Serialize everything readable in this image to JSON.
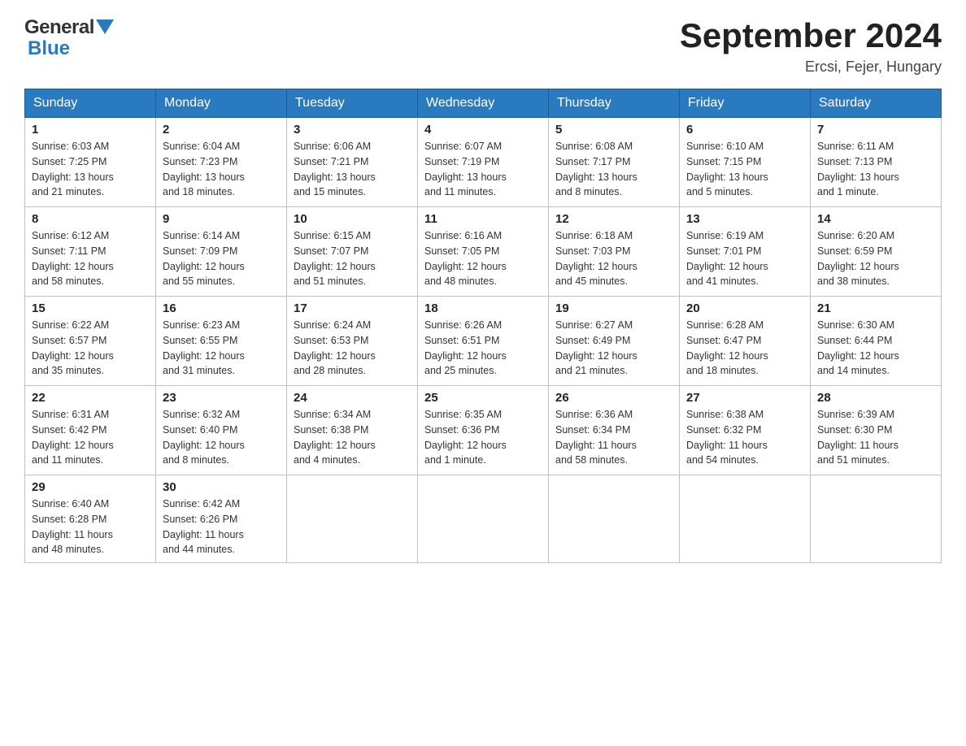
{
  "header": {
    "logo_general": "General",
    "logo_blue": "Blue",
    "title": "September 2024",
    "subtitle": "Ercsi, Fejer, Hungary"
  },
  "weekdays": [
    "Sunday",
    "Monday",
    "Tuesday",
    "Wednesday",
    "Thursday",
    "Friday",
    "Saturday"
  ],
  "weeks": [
    [
      {
        "day": "1",
        "info": "Sunrise: 6:03 AM\nSunset: 7:25 PM\nDaylight: 13 hours\nand 21 minutes."
      },
      {
        "day": "2",
        "info": "Sunrise: 6:04 AM\nSunset: 7:23 PM\nDaylight: 13 hours\nand 18 minutes."
      },
      {
        "day": "3",
        "info": "Sunrise: 6:06 AM\nSunset: 7:21 PM\nDaylight: 13 hours\nand 15 minutes."
      },
      {
        "day": "4",
        "info": "Sunrise: 6:07 AM\nSunset: 7:19 PM\nDaylight: 13 hours\nand 11 minutes."
      },
      {
        "day": "5",
        "info": "Sunrise: 6:08 AM\nSunset: 7:17 PM\nDaylight: 13 hours\nand 8 minutes."
      },
      {
        "day": "6",
        "info": "Sunrise: 6:10 AM\nSunset: 7:15 PM\nDaylight: 13 hours\nand 5 minutes."
      },
      {
        "day": "7",
        "info": "Sunrise: 6:11 AM\nSunset: 7:13 PM\nDaylight: 13 hours\nand 1 minute."
      }
    ],
    [
      {
        "day": "8",
        "info": "Sunrise: 6:12 AM\nSunset: 7:11 PM\nDaylight: 12 hours\nand 58 minutes."
      },
      {
        "day": "9",
        "info": "Sunrise: 6:14 AM\nSunset: 7:09 PM\nDaylight: 12 hours\nand 55 minutes."
      },
      {
        "day": "10",
        "info": "Sunrise: 6:15 AM\nSunset: 7:07 PM\nDaylight: 12 hours\nand 51 minutes."
      },
      {
        "day": "11",
        "info": "Sunrise: 6:16 AM\nSunset: 7:05 PM\nDaylight: 12 hours\nand 48 minutes."
      },
      {
        "day": "12",
        "info": "Sunrise: 6:18 AM\nSunset: 7:03 PM\nDaylight: 12 hours\nand 45 minutes."
      },
      {
        "day": "13",
        "info": "Sunrise: 6:19 AM\nSunset: 7:01 PM\nDaylight: 12 hours\nand 41 minutes."
      },
      {
        "day": "14",
        "info": "Sunrise: 6:20 AM\nSunset: 6:59 PM\nDaylight: 12 hours\nand 38 minutes."
      }
    ],
    [
      {
        "day": "15",
        "info": "Sunrise: 6:22 AM\nSunset: 6:57 PM\nDaylight: 12 hours\nand 35 minutes."
      },
      {
        "day": "16",
        "info": "Sunrise: 6:23 AM\nSunset: 6:55 PM\nDaylight: 12 hours\nand 31 minutes."
      },
      {
        "day": "17",
        "info": "Sunrise: 6:24 AM\nSunset: 6:53 PM\nDaylight: 12 hours\nand 28 minutes."
      },
      {
        "day": "18",
        "info": "Sunrise: 6:26 AM\nSunset: 6:51 PM\nDaylight: 12 hours\nand 25 minutes."
      },
      {
        "day": "19",
        "info": "Sunrise: 6:27 AM\nSunset: 6:49 PM\nDaylight: 12 hours\nand 21 minutes."
      },
      {
        "day": "20",
        "info": "Sunrise: 6:28 AM\nSunset: 6:47 PM\nDaylight: 12 hours\nand 18 minutes."
      },
      {
        "day": "21",
        "info": "Sunrise: 6:30 AM\nSunset: 6:44 PM\nDaylight: 12 hours\nand 14 minutes."
      }
    ],
    [
      {
        "day": "22",
        "info": "Sunrise: 6:31 AM\nSunset: 6:42 PM\nDaylight: 12 hours\nand 11 minutes."
      },
      {
        "day": "23",
        "info": "Sunrise: 6:32 AM\nSunset: 6:40 PM\nDaylight: 12 hours\nand 8 minutes."
      },
      {
        "day": "24",
        "info": "Sunrise: 6:34 AM\nSunset: 6:38 PM\nDaylight: 12 hours\nand 4 minutes."
      },
      {
        "day": "25",
        "info": "Sunrise: 6:35 AM\nSunset: 6:36 PM\nDaylight: 12 hours\nand 1 minute."
      },
      {
        "day": "26",
        "info": "Sunrise: 6:36 AM\nSunset: 6:34 PM\nDaylight: 11 hours\nand 58 minutes."
      },
      {
        "day": "27",
        "info": "Sunrise: 6:38 AM\nSunset: 6:32 PM\nDaylight: 11 hours\nand 54 minutes."
      },
      {
        "day": "28",
        "info": "Sunrise: 6:39 AM\nSunset: 6:30 PM\nDaylight: 11 hours\nand 51 minutes."
      }
    ],
    [
      {
        "day": "29",
        "info": "Sunrise: 6:40 AM\nSunset: 6:28 PM\nDaylight: 11 hours\nand 48 minutes."
      },
      {
        "day": "30",
        "info": "Sunrise: 6:42 AM\nSunset: 6:26 PM\nDaylight: 11 hours\nand 44 minutes."
      },
      null,
      null,
      null,
      null,
      null
    ]
  ]
}
